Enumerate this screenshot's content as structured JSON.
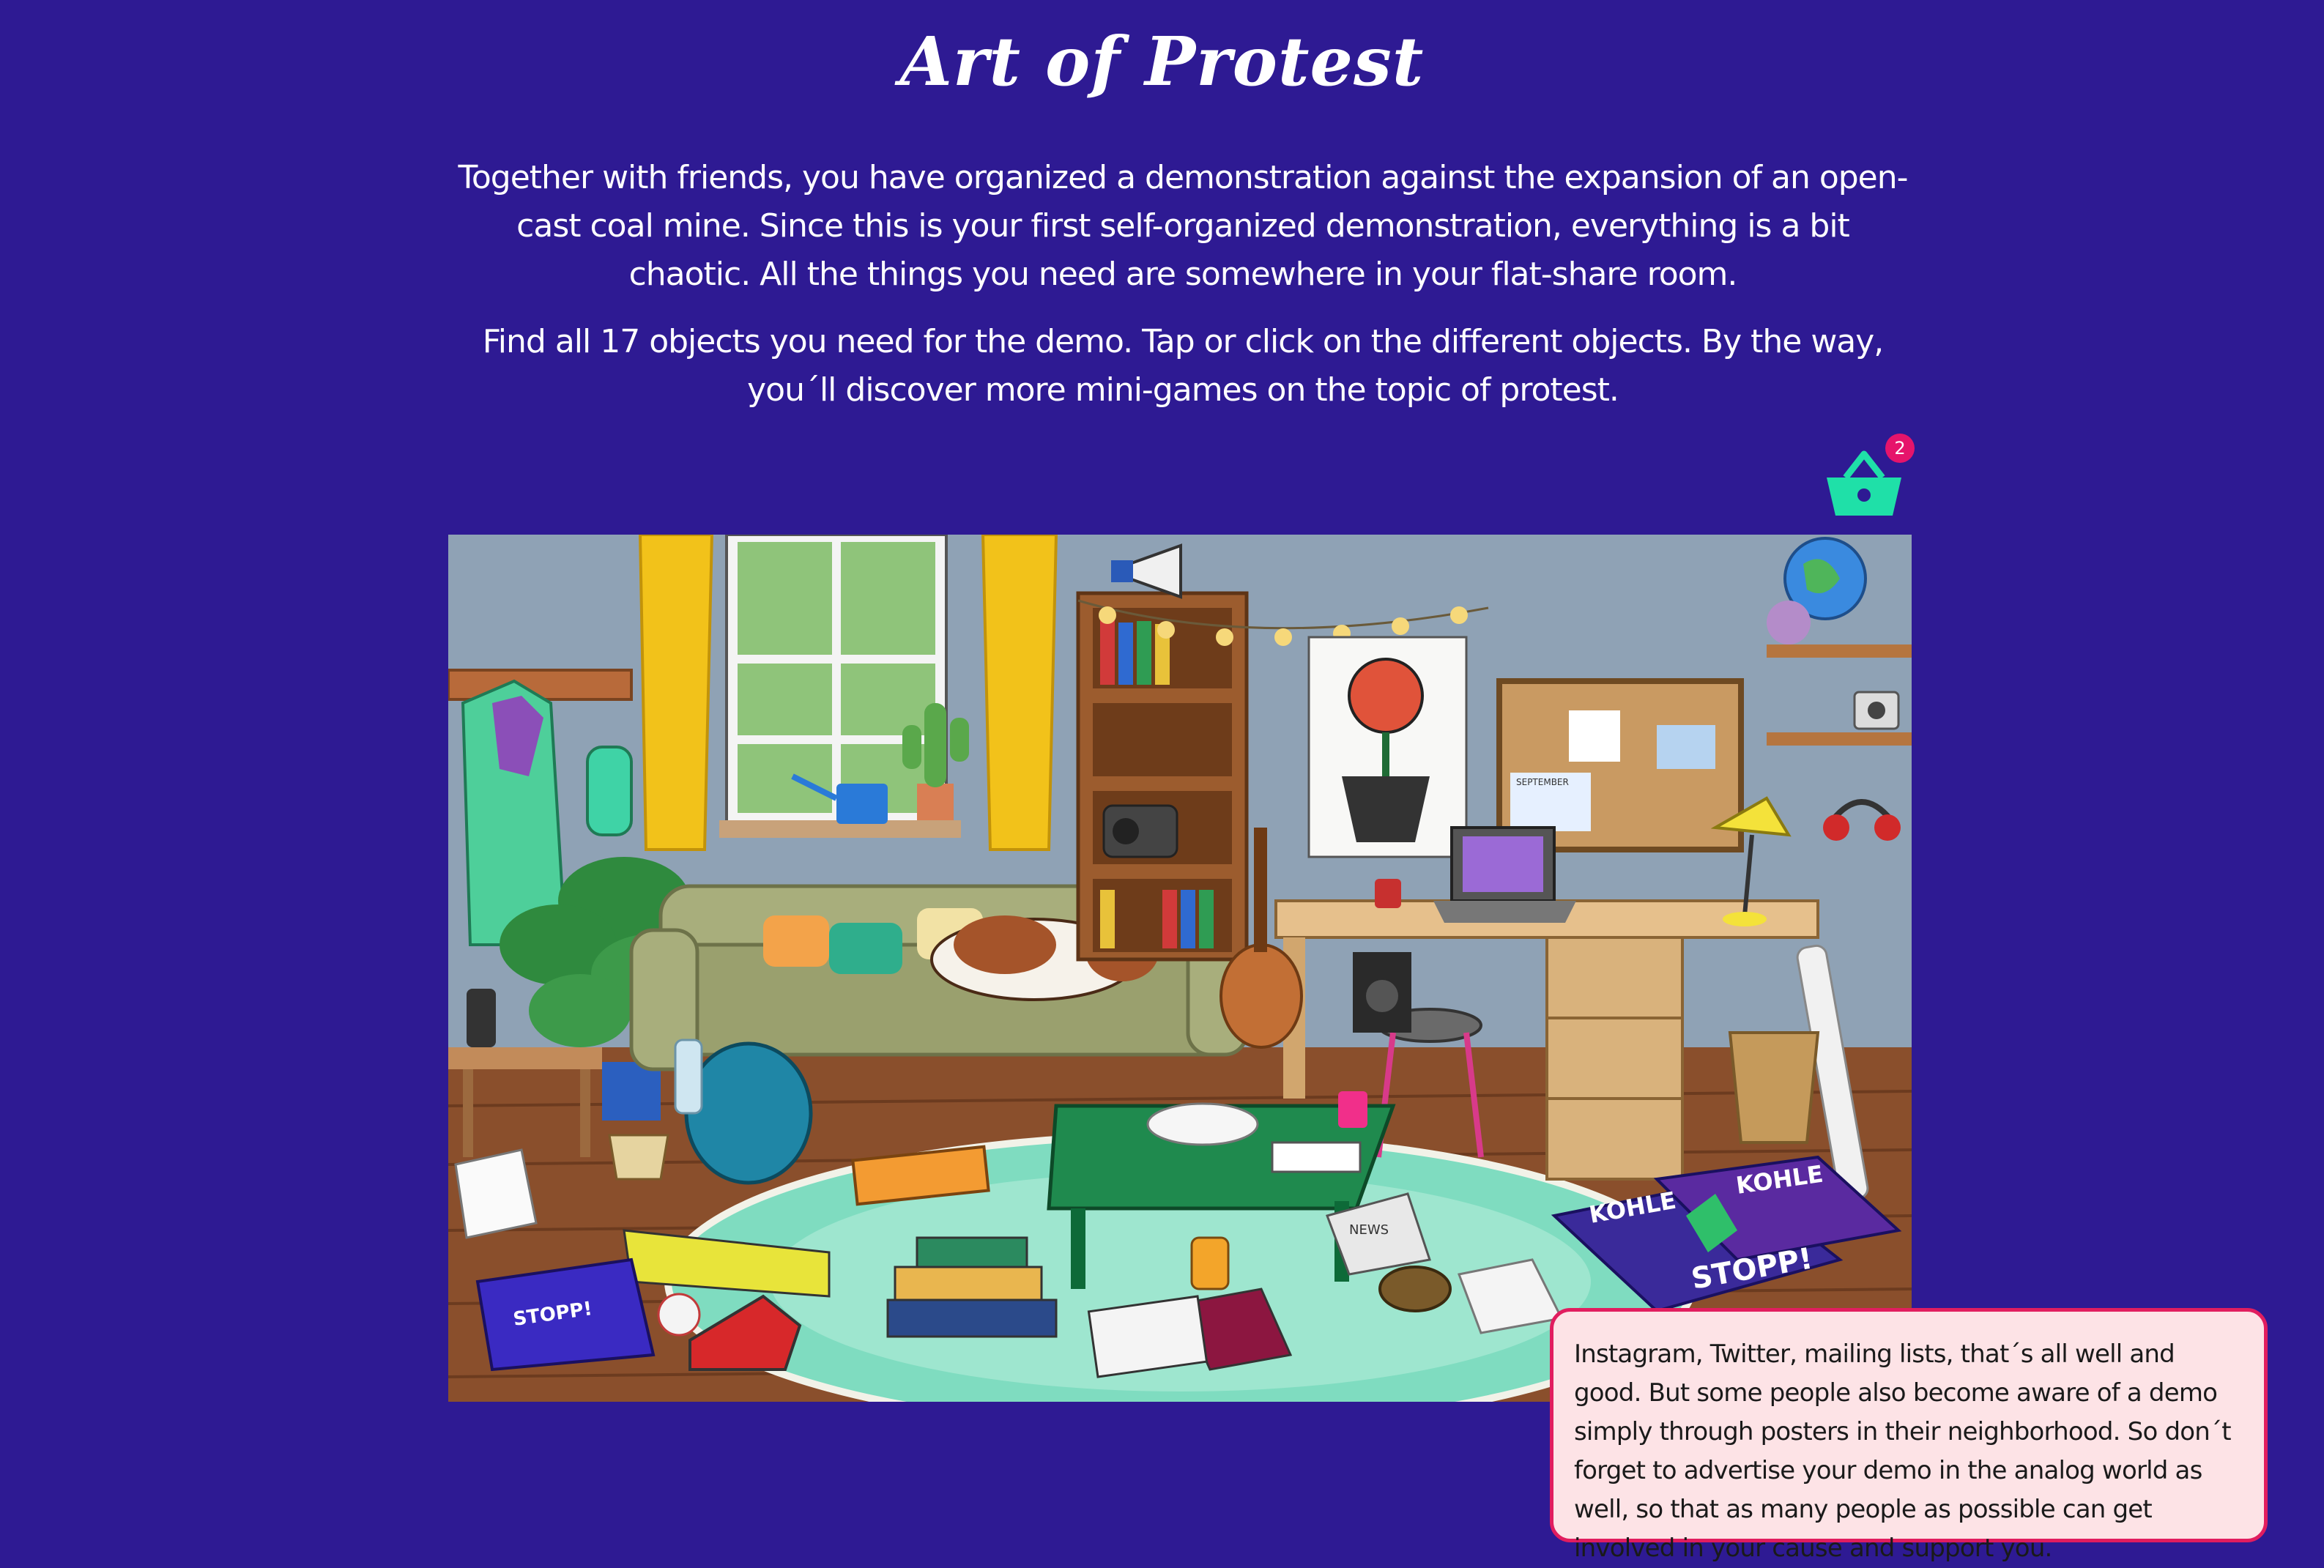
{
  "game": {
    "title": "Art of Protest",
    "intro_paragraphs": [
      "Together with friends, you have organized a demonstration against the expansion of an open-cast coal mine. Since this is your first self-organized demonstration, everything is a bit chaotic. All the things you need are somewhere in your flat-share room.",
      "Find all 17 objects you need for the demo. Tap or click on the different objects. By the way, you´ll discover more mini-games on the topic of protest."
    ]
  },
  "basket": {
    "icon": "shopping-basket-icon",
    "count": "2",
    "color": "#1fe0a8",
    "badge_color": "#e6146b"
  },
  "scene": {
    "poster_text_left": "STOPP!",
    "poster_text_right_top": "KOHLE",
    "poster_text_right_top2": "KOHLE",
    "poster_text_right_bottom": "STOPP!",
    "newspaper_text": "NEWS",
    "calendar_text": "SEPTEMBER"
  },
  "tooltip": {
    "text": "Instagram, Twitter, mailing lists, that´s all well and good. But some people also become aware of a demo simply through posters in their neighborhood. So don´t forget to advertise your demo in the analog world as well, so that as many people as possible can get involved in your cause and support you."
  },
  "colors": {
    "background": "#2e1a93",
    "tooltip_border": "#e11d5f",
    "tooltip_bg": "#fde3e6"
  }
}
